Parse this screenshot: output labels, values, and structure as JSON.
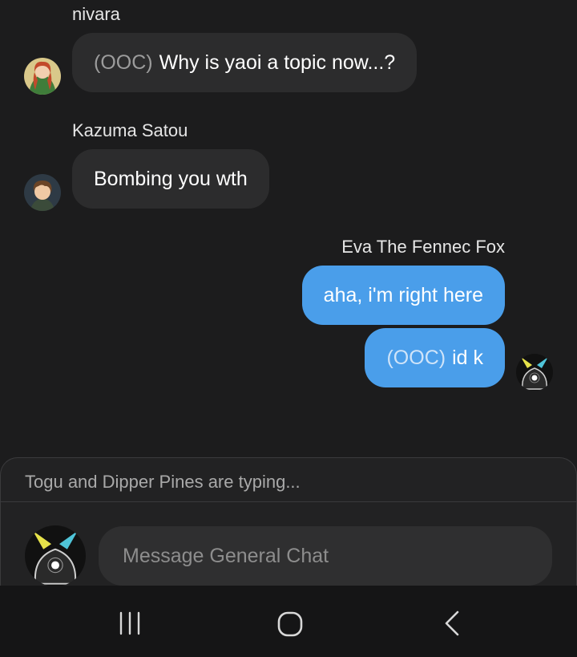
{
  "messages": [
    {
      "author": "nivara",
      "prefix": "(OOC)",
      "text": "Why is yaoi a topic now...?",
      "side": "left",
      "avatar_icon": "girl-avatar-icon"
    },
    {
      "author": "Kazuma Satou",
      "prefix": "",
      "text": "Bombing you wth",
      "side": "left",
      "avatar_icon": "boy-avatar-icon"
    },
    {
      "author": "Eva The Fennec Fox",
      "prefix": "",
      "text": "aha, i'm right here",
      "side": "right",
      "avatar_icon": ""
    },
    {
      "author": "",
      "prefix": "(OOC)",
      "text": "id  k",
      "side": "right",
      "avatar_icon": "creature-avatar-icon"
    }
  ],
  "typing_indicator": "Togu and Dipper Pines are typing...",
  "composer": {
    "placeholder": "Message General Chat",
    "avatar_icon": "creature-avatar-icon"
  },
  "navbar": {
    "recents_icon": "recents-icon",
    "home_icon": "home-icon",
    "back_icon": "back-icon"
  },
  "colors": {
    "background": "#1c1c1d",
    "incoming_bubble": "#2c2c2d",
    "outgoing_bubble": "#4a9eea",
    "panel": "#222223",
    "navbar": "#151516"
  }
}
